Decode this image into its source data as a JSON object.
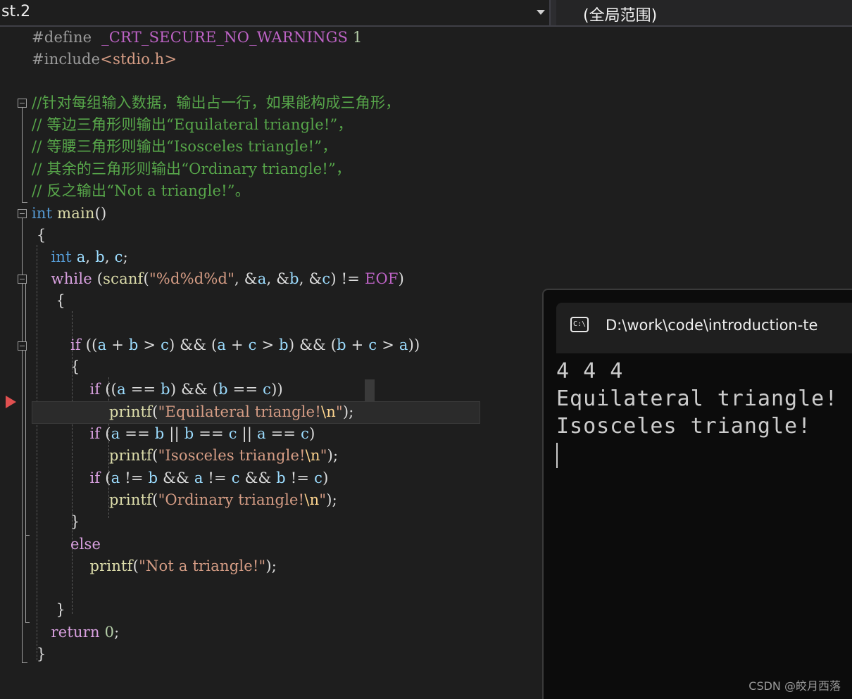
{
  "toolbar": {
    "project_dropdown": "st.2",
    "scope_dropdown": "(全局范围)"
  },
  "code": {
    "define_kw": "#define",
    "define_name": "_CRT_SECURE_NO_WARNINGS",
    "define_val": "1",
    "include_kw": "#include",
    "include_file": "<stdio.h>",
    "comment1": "//针对每组输入数据，输出占一行，如果能构成三角形，",
    "comment2": "// 等边三角形则输出“Equilateral triangle!”，",
    "comment3": "// 等腰三角形则输出“Isosceles triangle!”，",
    "comment4": "// 其余的三角形则输出“Ordinary triangle!”，",
    "comment5": "// 反之输出“Not a triangle!”。",
    "int_kw": "int",
    "main_fn": "main",
    "while_kw": "while",
    "if_kw": "if",
    "else_kw": "else",
    "return_kw": "return",
    "scanf_fn": "scanf",
    "printf_fn": "printf",
    "fmt_str": "\"%d%d%d\"",
    "eof": "EOF",
    "str_eq": "\"Equilateral triangle!",
    "str_iso": "\"Isosceles triangle!",
    "str_ord": "\"Ordinary triangle!",
    "str_not": "\"Not a triangle!\"",
    "newline_esc": "\\n",
    "quote": "\"",
    "zero": "0"
  },
  "console": {
    "title": "D:\\work\\code\\introduction-te",
    "icon_label": "C:\\",
    "output": [
      "4 4 4",
      "Equilateral triangle!",
      "Isosceles triangle!"
    ]
  },
  "watermark": "CSDN @皎月西落",
  "colors": {
    "keyword": "#569cd6",
    "control": "#d8a0df",
    "string": "#d69d85",
    "comment": "#57a64a",
    "breakpoint_arrow": "#e05050"
  }
}
